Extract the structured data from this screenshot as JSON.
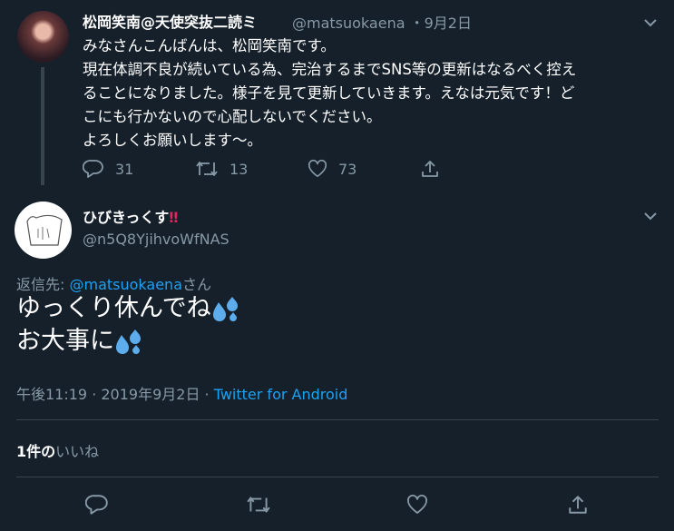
{
  "tweet1": {
    "display_name": "松岡笑南@天使突抜二読ミ",
    "handle": "@matsuokaena",
    "date": "・9月2日",
    "lines": [
      "みなさんこんばんは、松岡笑南です。",
      "現在体調不良が続いている為、完治するまでSNS等の更新はなるべく控え",
      "ることになりました。様子を見て更新していきます。えなは元気です！ど",
      "こにも行かないので心配しないでください。",
      "よろしくお願いします〜。"
    ],
    "reply_count": "31",
    "retweet_count": "13",
    "like_count": "73"
  },
  "reply": {
    "display_name": "ひびきっくす",
    "name_emoji": "‼",
    "handle": "@n5Q8YjihvoWfNAS",
    "replying_to_prefix": "返信先: ",
    "replying_to_handle": "@matsuokaena",
    "replying_to_suffix": "さん",
    "line1": "ゆっくり休んでね",
    "line2": "お大事に",
    "time": "午後11:19 · 2019年9月2日 · ",
    "source": "Twitter for Android",
    "likes_count": "1件の",
    "likes_label": "いいね"
  },
  "icons": {
    "more": "chevron-down-icon",
    "reply": "reply-icon",
    "retweet": "retweet-icon",
    "like": "heart-icon",
    "share": "share-icon",
    "emoji": "sweat-droplets-emoji"
  },
  "colors": {
    "background": "#15202b",
    "muted": "#8899a6",
    "link": "#1da1f2",
    "emoji": "#5dadec",
    "alert": "#e0245e"
  }
}
